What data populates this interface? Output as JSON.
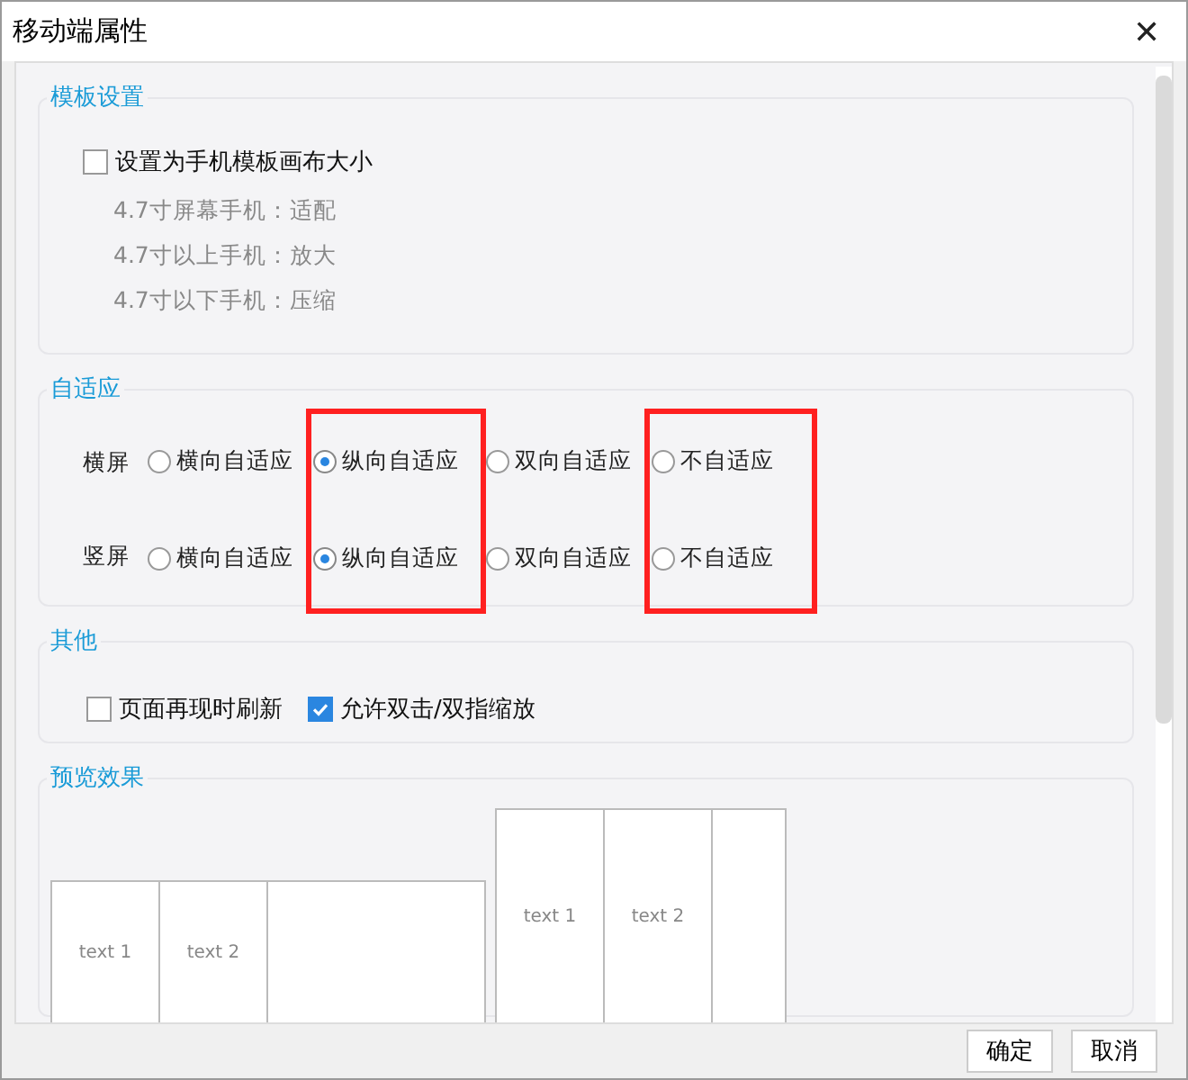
{
  "window": {
    "title": "移动端属性",
    "close": "✕"
  },
  "template_settings": {
    "title": "模板设置",
    "checkbox": {
      "label": "设置为手机模板画布大小",
      "checked": false
    },
    "notes": [
      "4.7寸屏幕手机：适配",
      "4.7寸以上手机：放大",
      "4.7寸以下手机：压缩"
    ]
  },
  "adaptive": {
    "title": "自适应",
    "rows": [
      {
        "label": "横屏",
        "options": [
          {
            "label": "横向自适应",
            "selected": false,
            "highlighted": false
          },
          {
            "label": "纵向自适应",
            "selected": true,
            "highlighted": true
          },
          {
            "label": "双向自适应",
            "selected": false,
            "highlighted": false
          },
          {
            "label": "不自适应",
            "selected": false,
            "highlighted": true
          }
        ]
      },
      {
        "label": "竖屏",
        "options": [
          {
            "label": "横向自适应",
            "selected": false,
            "highlighted": false
          },
          {
            "label": "纵向自适应",
            "selected": true,
            "highlighted": true
          },
          {
            "label": "双向自适应",
            "selected": false,
            "highlighted": false
          },
          {
            "label": "不自适应",
            "selected": false,
            "highlighted": true
          }
        ]
      }
    ]
  },
  "other": {
    "title": "其他",
    "checkboxes": [
      {
        "label": "页面再现时刷新",
        "checked": false
      },
      {
        "label": "允许双击/双指缩放",
        "checked": true
      }
    ]
  },
  "preview": {
    "title": "预览效果",
    "landscape": [
      "text 1",
      "text 2"
    ],
    "portrait": [
      "text 1",
      "text 2"
    ]
  },
  "buttons": [
    "确定",
    "取消"
  ]
}
